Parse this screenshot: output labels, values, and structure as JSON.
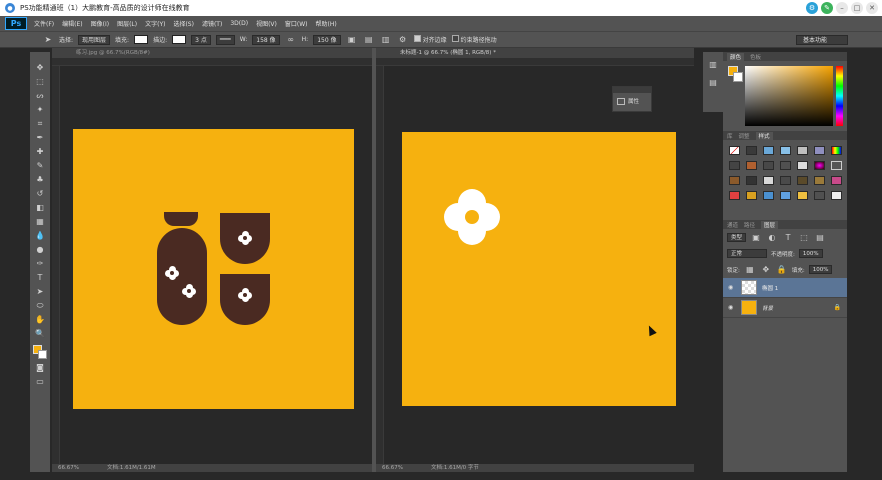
{
  "window": {
    "title": "PS功能精通班（1）大鹏教育-高品质的设计师在线教育"
  },
  "app": {
    "logo": "Ps"
  },
  "menu": [
    "文件(F)",
    "编辑(E)",
    "图像(I)",
    "图层(L)",
    "文字(Y)",
    "选择(S)",
    "滤镜(T)",
    "3D(D)",
    "视图(V)",
    "窗口(W)",
    "帮助(H)"
  ],
  "options": {
    "select_label": "选择:",
    "select_value": "现用图层",
    "fill_label": "填充:",
    "stroke_label": "描边:",
    "stroke_size": "3 点",
    "w_label": "W:",
    "w_value": "158 像",
    "h_label": "H:",
    "h_value": "150 像",
    "align_edges": "对齐边缘",
    "constrain": "约束路径拖动",
    "workspace": "基本功能"
  },
  "docs": [
    {
      "tab": "练习.jpg @ 66.7%(RGB/8#)",
      "status_zoom": "66.67%",
      "status_info": "文档:1.61M/1.61M"
    },
    {
      "tab": "未标题-1 @ 66.7% (椭圆 1, RGB/8) *",
      "status_zoom": "66.67%",
      "status_info": "文档:1.61M/0 字节"
    }
  ],
  "properties_panel": {
    "label": "属性"
  },
  "color_panel": {
    "tabs": [
      "颜色",
      "色板"
    ],
    "fg": "#f6b10f",
    "bg": "#ffffff"
  },
  "styles_panel": {
    "tabs": [
      "库",
      "调整",
      "样式"
    ]
  },
  "layers_panel": {
    "tabs": [
      "通道",
      "路径",
      "图层"
    ],
    "kind": "类型",
    "mode": "正常",
    "opacity_label": "不透明度:",
    "opacity": "100%",
    "lock_label": "锁定:",
    "fill_label": "填充:",
    "fill": "100%",
    "layers": [
      {
        "name": "椭圆 1",
        "selected": true
      },
      {
        "name": "背景",
        "selected": false
      }
    ]
  },
  "colors": {
    "canvas": "#f6b10f",
    "shape": "#4a2a22",
    "ui": "#535353"
  }
}
